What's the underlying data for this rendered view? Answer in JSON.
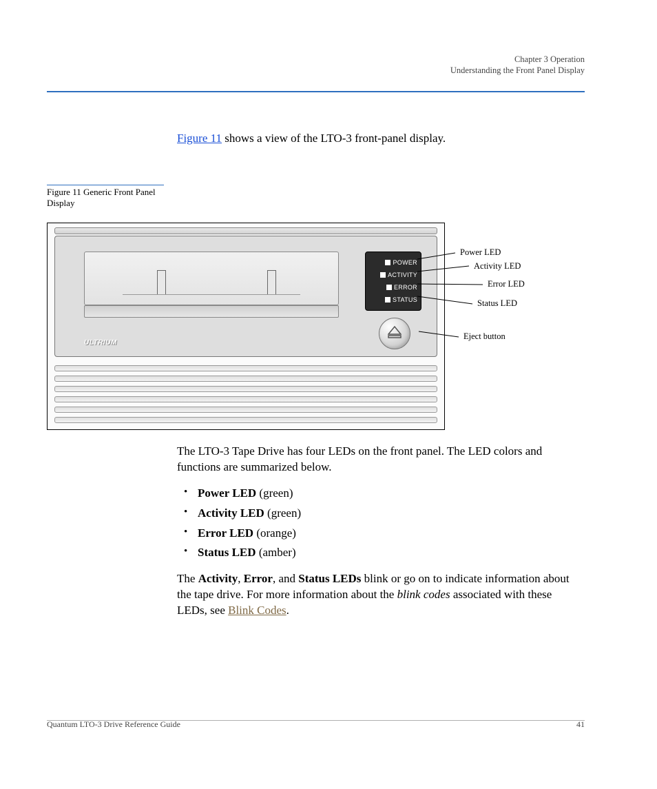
{
  "header": {
    "chapter": "Chapter 3  Operation",
    "section": "Understanding the Front Panel Display"
  },
  "intro": {
    "fig_link": "Figure 11",
    "rest": " shows a view of the LTO-3 front-panel display."
  },
  "side_caption": "Figure 11  Generic Front Panel Display",
  "leds": {
    "power": "POWER",
    "activity": "ACTIVITY",
    "error": "ERROR",
    "status": "STATUS"
  },
  "logo": "ULTRIUM",
  "callout_labels": {
    "power": "Power LED",
    "activity": "Activity LED",
    "error": "Error LED",
    "status": "Status LED",
    "eject": "Eject button"
  },
  "after_figure": "The LTO-3 Tape Drive has four LEDs on the front panel. The LED colors and functions are summarized below.",
  "bullets": [
    {
      "name": "Power LED",
      "color": " (green)"
    },
    {
      "name": "Activity LED",
      "color": " (green)"
    },
    {
      "name": "Error LED",
      "color": " (orange)"
    },
    {
      "name": "Status LED",
      "color": " (amber)"
    }
  ],
  "closing": {
    "t1": "The ",
    "ActivityLabel": "Activity",
    "t2": ", ",
    "ErrorLabel": "Error",
    "t3": ", and ",
    "StatusLEDsLabel": "Status LEDs",
    "t4": " blink or go on to indicate information about the tape drive. For more information about the ",
    "blink_codes_phrase": "blink codes",
    "t5": " associated with these LEDs, see ",
    "link": "Blink Codes",
    "t6": "."
  },
  "footer": {
    "left": "Quantum LTO-3 Drive Reference Guide",
    "right": "41"
  }
}
